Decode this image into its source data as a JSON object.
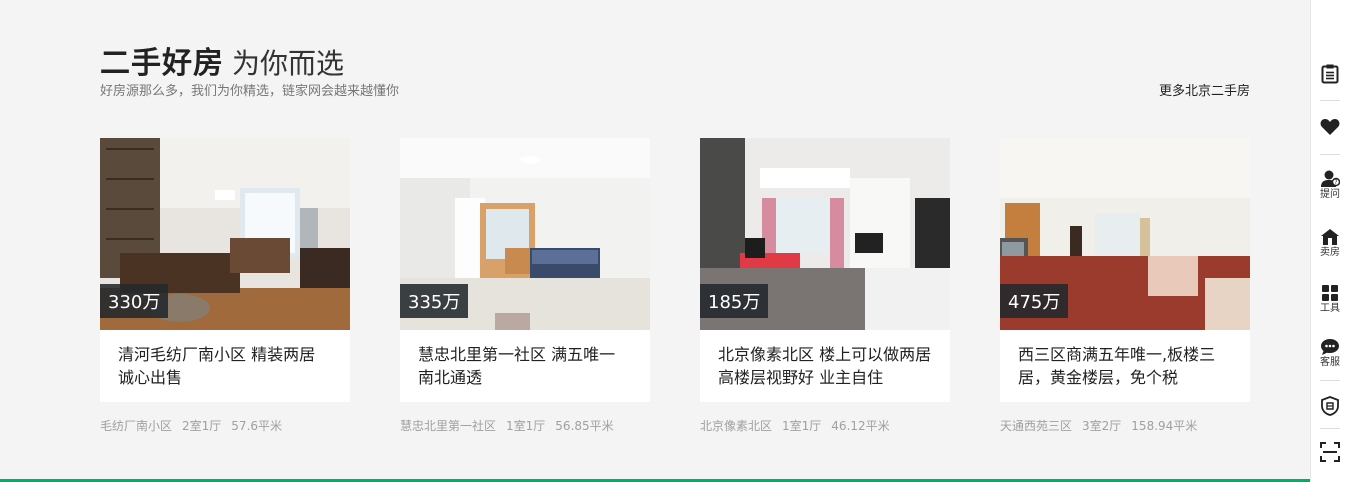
{
  "section": {
    "title_main": "二手好房",
    "title_sub": "为你而选",
    "subtitle": "好房源那么多，我们为你精选，链家网会越来越懂你",
    "more_link": "更多北京二手房"
  },
  "listings": [
    {
      "price": "330万",
      "title": "清河毛纺厂南小区 精装两居 诚心出售",
      "community": "毛纺厂南小区",
      "layout": "2室1厅",
      "area": "57.6平米"
    },
    {
      "price": "335万",
      "title": "慧忠北里第一社区 满五唯一 南北通透",
      "community": "慧忠北里第一社区",
      "layout": "1室1厅",
      "area": "56.85平米"
    },
    {
      "price": "185万",
      "title": "北京像素北区 楼上可以做两居 高楼层视野好 业主自住",
      "community": "北京像素北区",
      "layout": "1室1厅",
      "area": "46.12平米"
    },
    {
      "price": "475万",
      "title": "西三区商满五年唯一,板楼三居，黄金楼层，免个税",
      "community": "天通西苑三区",
      "layout": "3室2厅",
      "area": "158.94平米"
    }
  ],
  "sidebar": {
    "items": [
      {
        "icon": "clipboard-icon",
        "label": ""
      },
      {
        "icon": "heart-icon",
        "label": ""
      },
      {
        "icon": "question-person-icon",
        "label": "提问"
      },
      {
        "icon": "house-sell-icon",
        "label": "卖房"
      },
      {
        "icon": "tools-grid-icon",
        "label": "工具"
      },
      {
        "icon": "chat-bubble-icon",
        "label": "客服"
      },
      {
        "icon": "shield-icon",
        "label": ""
      },
      {
        "icon": "scan-icon",
        "label": ""
      }
    ]
  },
  "colors": {
    "accent": "#00ae66",
    "price_tag_bg": "#22282c",
    "page_bg": "#f4f4f4"
  }
}
